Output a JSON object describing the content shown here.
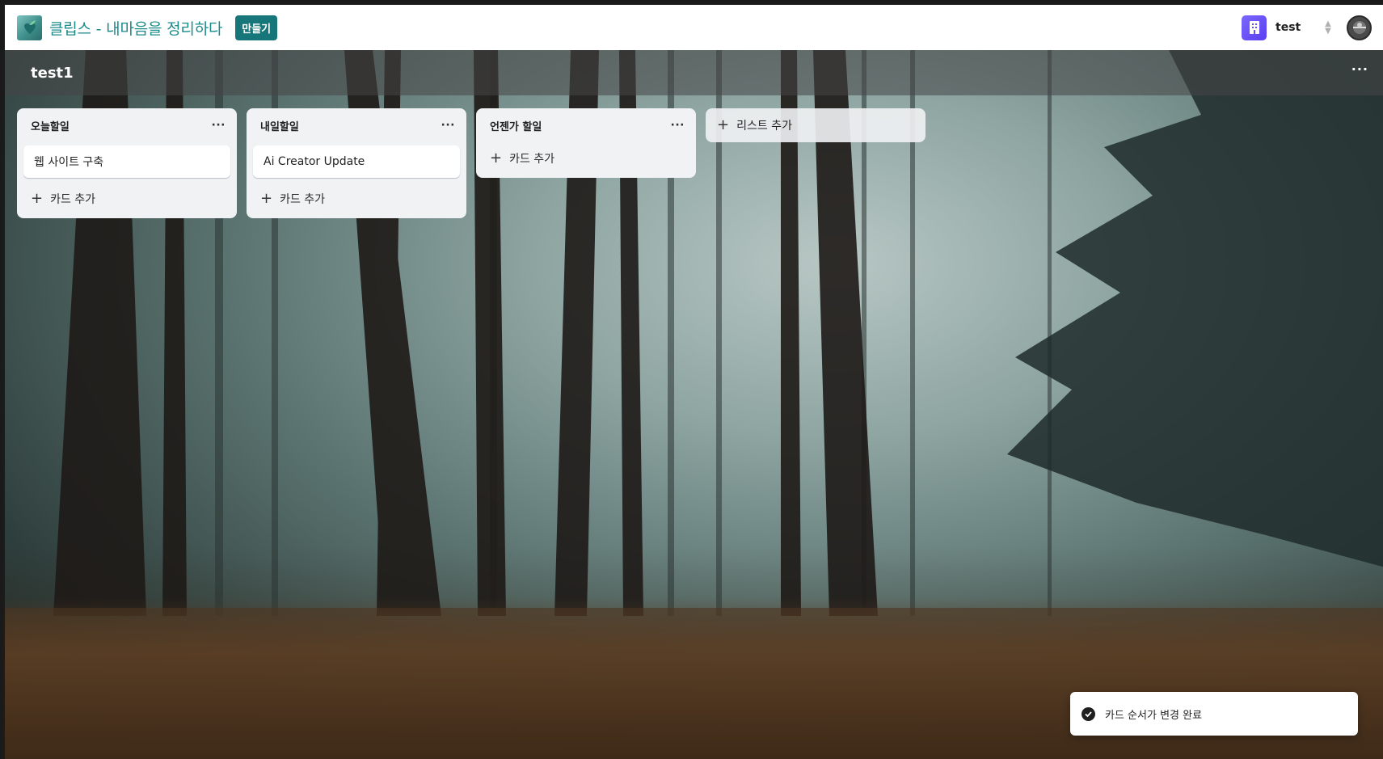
{
  "app": {
    "title": "클립스 - 내마음을 정리하다",
    "create_label": "만들기",
    "logo_icon": "heart-leaf-logo",
    "accent_color": "#16767a"
  },
  "workspace": {
    "name": "test",
    "badge_icon": "building-icon",
    "switch_icon": "chevron-up-down-icon"
  },
  "user": {
    "avatar_icon": "user-avatar-icon"
  },
  "board": {
    "title": "test1",
    "menu_label": "···",
    "background": "foggy forest photo"
  },
  "lists": [
    {
      "title": "오늘할일",
      "menu_label": "···",
      "cards": [
        "웹 사이트 구축"
      ],
      "add_card_label": "카드 추가"
    },
    {
      "title": "내일할일",
      "menu_label": "···",
      "cards": [
        "Ai Creator Update"
      ],
      "add_card_label": "카드 추가"
    },
    {
      "title": "언젠가 할일",
      "menu_label": "···",
      "cards": [],
      "add_card_label": "카드 추가"
    }
  ],
  "add_list_label": "리스트 추가",
  "toast": {
    "message": "카드 순서가 변경 완료",
    "icon": "check-circle-icon"
  }
}
